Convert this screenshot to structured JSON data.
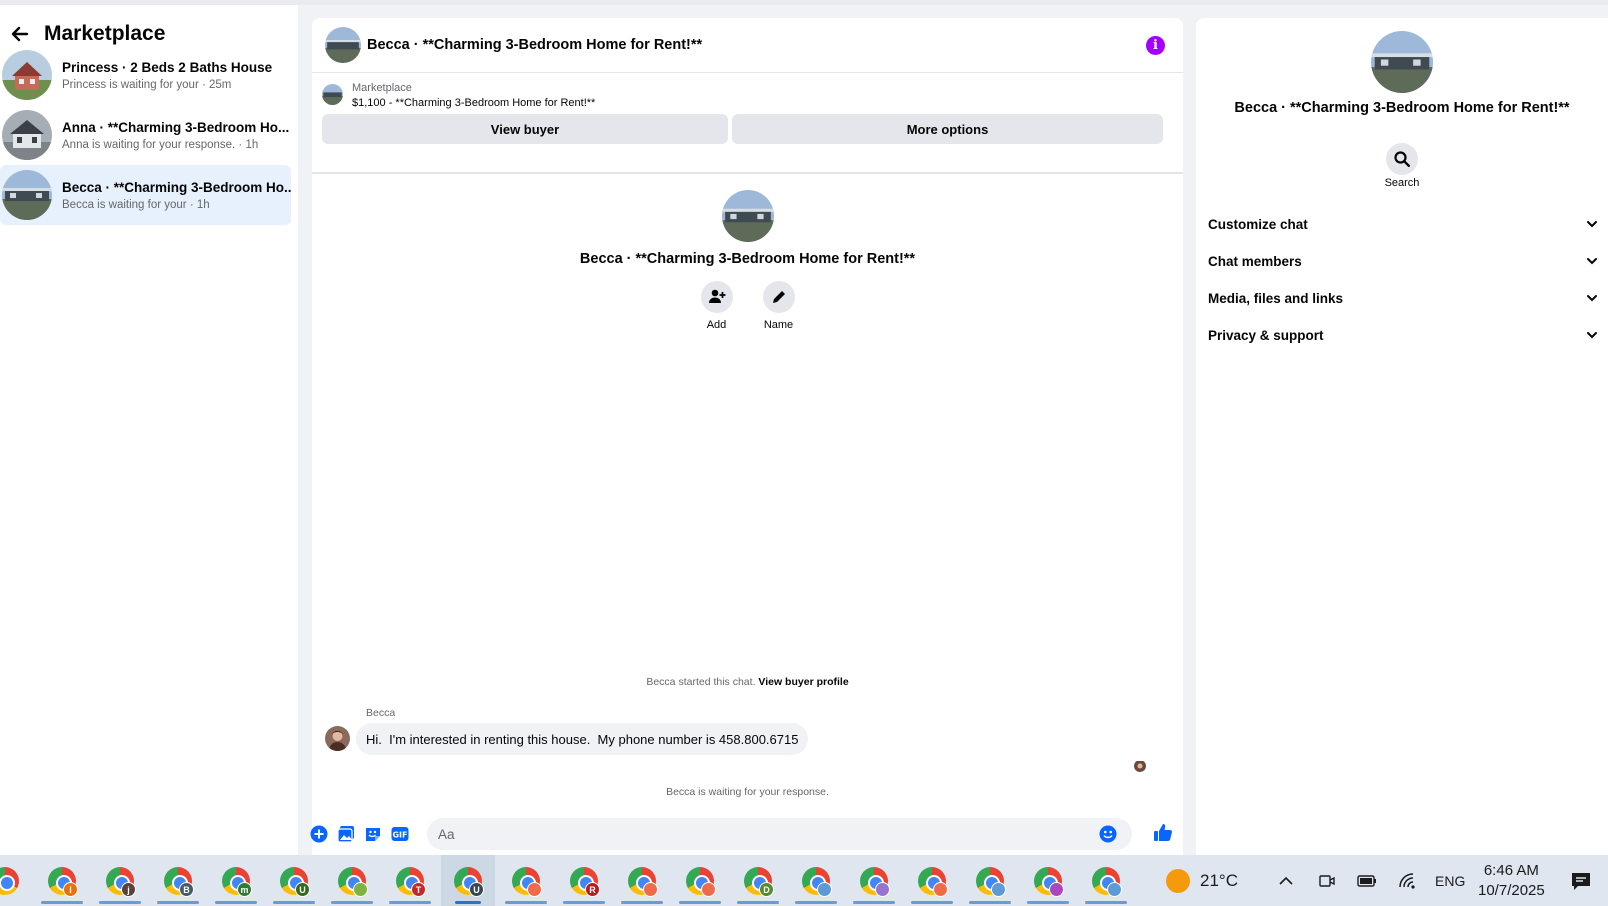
{
  "sidebar": {
    "title": "Marketplace",
    "conversations": [
      {
        "name": "Princess · 2 Beds 2 Baths House",
        "sub": "Princess is waiting for your · 25m"
      },
      {
        "name": "Anna · **Charming 3-Bedroom Ho...",
        "sub": "Anna is waiting for your response. · 1h"
      },
      {
        "name": "Becca · **Charming 3-Bedroom Ho...",
        "sub": "Becca is waiting for your · 1h"
      }
    ]
  },
  "chat": {
    "header_title": "Becca · **Charming 3-Bedroom Home for Rent!**",
    "marketplace_label": "Marketplace",
    "listing_line": "$1,100 - **Charming 3-Bedroom Home for Rent!**",
    "view_buyer": "View buyer",
    "more_options": "More options",
    "profile_name": "Becca · **Charming 3-Bedroom Home for Rent!**",
    "add_label": "Add",
    "name_label": "Name",
    "started_text": "Becca started this chat.",
    "view_profile_link": "View buyer profile",
    "sender": "Becca",
    "message": "Hi.  I'm interested in renting this house.  My phone number is 458.800.6715",
    "waiting_text": "Becca is waiting for your response.",
    "input_placeholder": "Aa",
    "info_glyph": "i"
  },
  "right_panel": {
    "title": "Becca · **Charming 3-Bedroom Home for Rent!**",
    "search_label": "Search",
    "sections": [
      "Customize chat",
      "Chat members",
      "Media, files and links",
      "Privacy & support"
    ]
  },
  "taskbar": {
    "apps": [
      {
        "badge": "I",
        "color": "#e8710a"
      },
      {
        "badge": "j",
        "color": "#5d4037"
      },
      {
        "badge": "B",
        "color": "#455a64"
      },
      {
        "badge": "m",
        "color": "#2e7d32"
      },
      {
        "badge": "U",
        "color": "#33691e"
      },
      {
        "badge": "",
        "color": "#7cb342"
      },
      {
        "badge": "T",
        "color": "#c62828"
      },
      {
        "badge": "U",
        "color": "#37474f"
      },
      {
        "badge": "",
        "color": "#ef6c4b"
      },
      {
        "badge": "R",
        "color": "#b71c1c"
      },
      {
        "badge": "",
        "color": "#ef6c4b"
      },
      {
        "badge": "",
        "color": "#ef6c4b"
      },
      {
        "badge": "D",
        "color": "#558b2f"
      },
      {
        "badge": "",
        "color": "#5c9bd6"
      },
      {
        "badge": "",
        "color": "#9575cd"
      },
      {
        "badge": "",
        "color": "#ef6c4b"
      },
      {
        "badge": "",
        "color": "#5c9bd6"
      },
      {
        "badge": "",
        "color": "#ab47bc"
      },
      {
        "badge": "",
        "color": "#5c9bd6"
      }
    ],
    "weather": "21°C",
    "language": "ENG",
    "time": "6:46 AM",
    "date": "10/7/2025"
  },
  "colors": {
    "accent": "#0866ff",
    "info": "#a100ff",
    "selected_row": "#e7f0fd"
  }
}
